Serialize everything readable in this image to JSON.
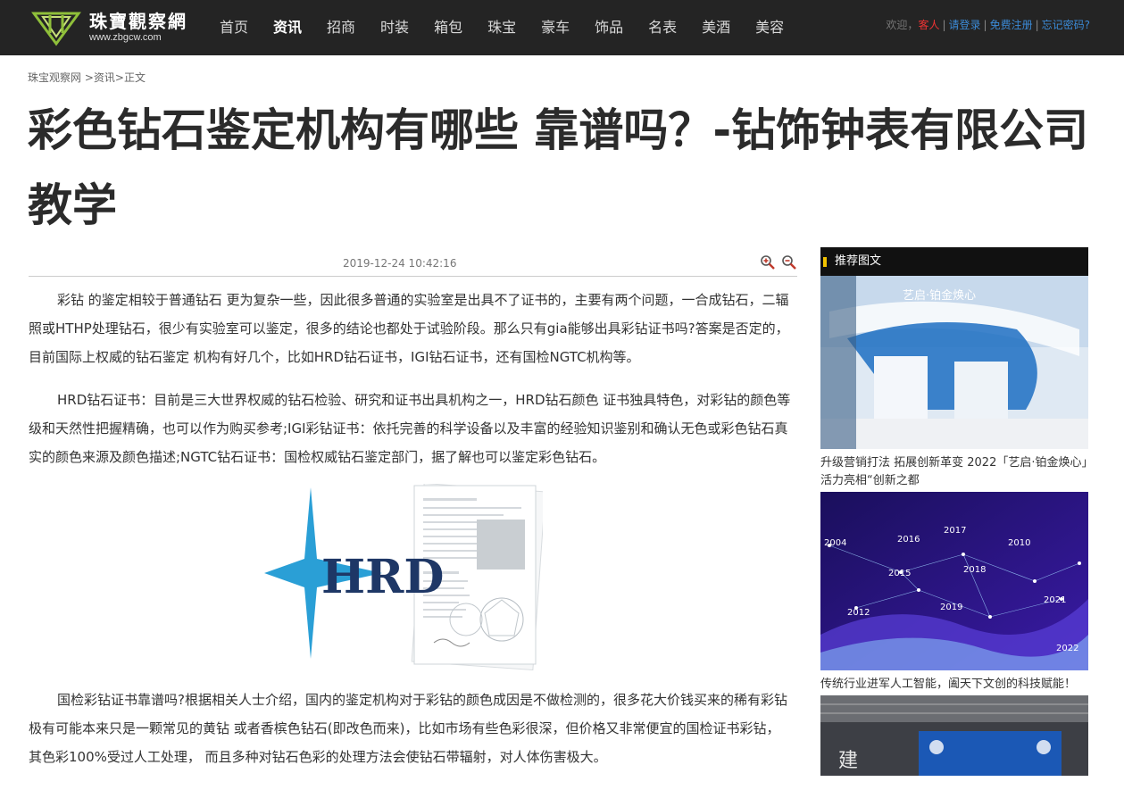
{
  "site": {
    "name": "珠寶觀察網",
    "url": "www.zbgcw.com"
  },
  "nav": [
    {
      "label": "首页",
      "active": false
    },
    {
      "label": "资讯",
      "active": true
    },
    {
      "label": "招商",
      "active": false
    },
    {
      "label": "时装",
      "active": false
    },
    {
      "label": "箱包",
      "active": false
    },
    {
      "label": "珠宝",
      "active": false
    },
    {
      "label": "豪车",
      "active": false
    },
    {
      "label": "饰品",
      "active": false
    },
    {
      "label": "名表",
      "active": false
    },
    {
      "label": "美酒",
      "active": false
    },
    {
      "label": "美容",
      "active": false
    }
  ],
  "user": {
    "welcome": "欢迎，",
    "guest": "客人",
    "login": "请登录",
    "register": "免费注册",
    "forgot": "忘记密码?",
    "sep": "|"
  },
  "breadcrumb": {
    "home": "珠宝观察网",
    "sep1": " >",
    "section": "资讯",
    "sep2": ">",
    "current": "正文"
  },
  "article": {
    "title": "彩色钻石鉴定机构有哪些 靠谱吗？-钻饰钟表有限公司教学",
    "date": "2019-12-24 10:42:16",
    "paragraphs": [
      "彩钻 的鉴定相较于普通钻石 更为复杂一些，因此很多普通的实验室是出具不了证书的，主要有两个问题，一合成钻石，二辐照或HTHP处理钻石，很少有实验室可以鉴定，很多的结论也都处于试验阶段。那么只有gia能够出具彩钻证书吗?答案是否定的，目前国际上权威的钻石鉴定 机构有好几个，比如HRD钻石证书，IGI钻石证书，还有国检NGTC机构等。",
      "HRD钻石证书：目前是三大世界权威的钻石检验、研究和证书出具机构之一，HRD钻石颜色 证书独具特色，对彩钻的颜色等级和天然性把握精确，也可以作为购买参考;IGI彩钻证书：依托完善的科学设备以及丰富的经验知识鉴别和确认无色或彩色钻石真实的颜色来源及颜色描述;NGTC钻石证书：国检权威钻石鉴定部门，据了解也可以鉴定彩色钻石。",
      "国检彩钻证书靠谱吗?根据相关人士介绍，国内的鉴定机构对于彩钻的颜色成因是不做检测的，很多花大价钱买来的稀有彩钻极有可能本来只是一颗常见的黄钻 或者香槟色钻石(即改色而来)，比如市场有些色彩很深，但价格又非常便宜的国检证书彩钻， 其色彩100%受过人工处理， 而且多种对钻石色彩的处理方法会使钻石带辐射，对人体伤害极大。"
    ],
    "image_logo_text": "HRD"
  },
  "sidebar": {
    "heading": "推荐图文",
    "cards": [
      {
        "caption": "升级营销打法 拓展创新革变 2022「艺启·铂金焕心」活力亮相“创新之都",
        "img_text": "艺启·铂金焕心"
      },
      {
        "caption": "传统行业进军人工智能，阖天下文创的科技赋能！",
        "img_years": [
          "2016",
          "2017",
          "2015",
          "2012",
          "2019",
          "2021",
          "2022",
          "2004",
          "2010",
          "2018"
        ]
      },
      {
        "caption": "",
        "img_text": "建"
      }
    ]
  },
  "colors": {
    "header_bg": "#242424",
    "accent_yellow": "#f2c200",
    "link_blue": "#3b8ad6",
    "guest_red": "#e33333"
  }
}
